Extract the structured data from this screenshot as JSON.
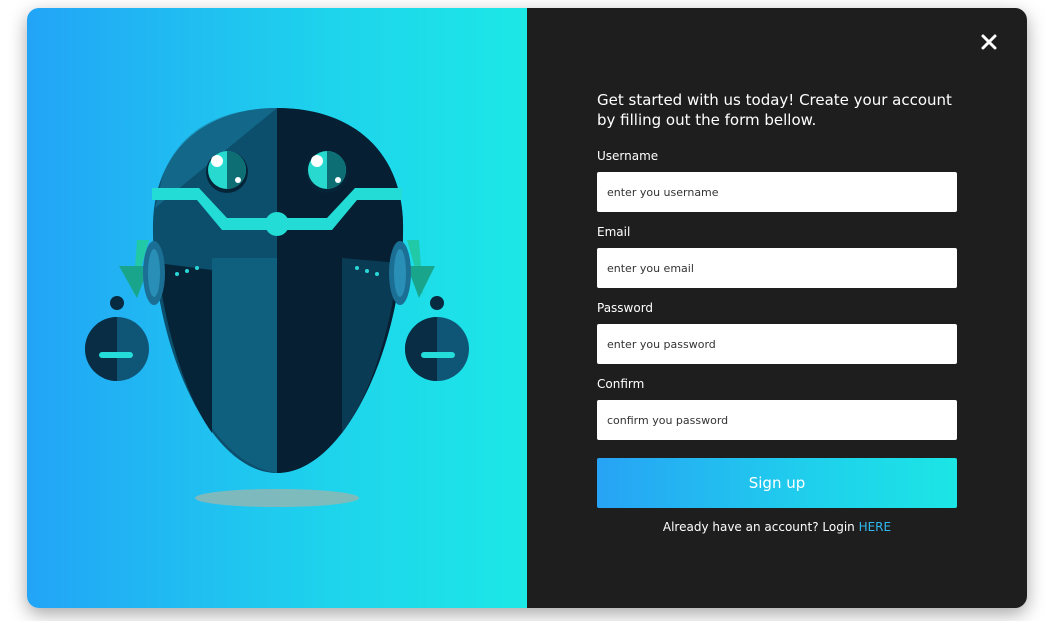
{
  "modal": {
    "intro_text": "Get started with us today! Create your account by filling out the form bellow.",
    "close_icon": "close-icon",
    "fields": [
      {
        "label": "Username",
        "placeholder": "enter you username"
      },
      {
        "label": "Email",
        "placeholder": "enter you email"
      },
      {
        "label": "Password",
        "placeholder": "enter you password"
      },
      {
        "label": "Confirm",
        "placeholder": "confirm you password"
      }
    ],
    "signup_label": "Sign up",
    "login_prompt": "Already have an account? Login ",
    "login_link": "HERE"
  },
  "colors": {
    "gradient_start": "#22a4f7",
    "gradient_end": "#1ce8e6",
    "form_background": "#1e1e1e",
    "link": "#31b8f0"
  },
  "illustration": "robot-illustration"
}
